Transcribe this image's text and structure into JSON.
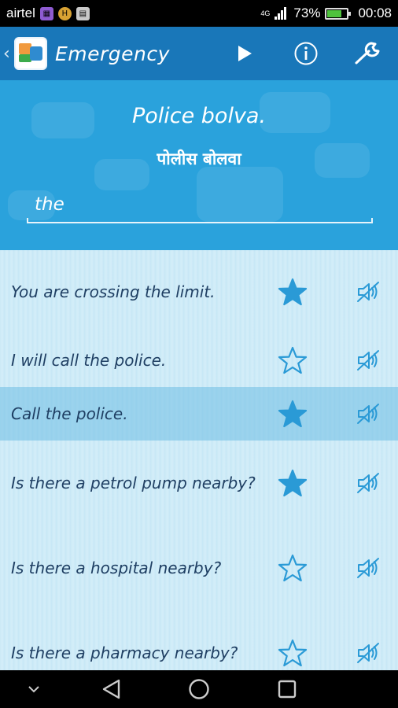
{
  "status_bar": {
    "carrier": "airtel",
    "network": "4G",
    "battery_percent": "73%",
    "battery_level": 0.73,
    "time": "00:08"
  },
  "app_bar": {
    "title": "Emergency",
    "icons": [
      "back-chevron-icon",
      "app-logo-icon",
      "play-icon",
      "info-icon",
      "wrench-icon"
    ]
  },
  "header": {
    "phrase_roman": "Police bolva.",
    "phrase_native": "पोलीस बोलवा",
    "search_value": "the"
  },
  "phrases": [
    {
      "text": "You are crossing the limit.",
      "starred": true,
      "selected": false
    },
    {
      "text": "I will call the police.",
      "starred": false,
      "selected": false
    },
    {
      "text": "Call the police.",
      "starred": true,
      "selected": true
    },
    {
      "text": "Is there a petrol pump nearby?",
      "starred": true,
      "selected": false
    },
    {
      "text": "Is there a hospital nearby?",
      "starred": false,
      "selected": false
    },
    {
      "text": "Is there a pharmacy nearby?",
      "starred": false,
      "selected": false
    }
  ],
  "colors": {
    "app_bar": "#1977b9",
    "header": "#2aa2dc",
    "list_text": "#1f3f63",
    "star": "#2a9ad6",
    "battery_fill": "#4fc33d"
  },
  "nav_bar": {
    "icons": [
      "keyboard-hide-icon",
      "back-triangle-icon",
      "home-circle-icon",
      "recents-square-icon"
    ]
  }
}
